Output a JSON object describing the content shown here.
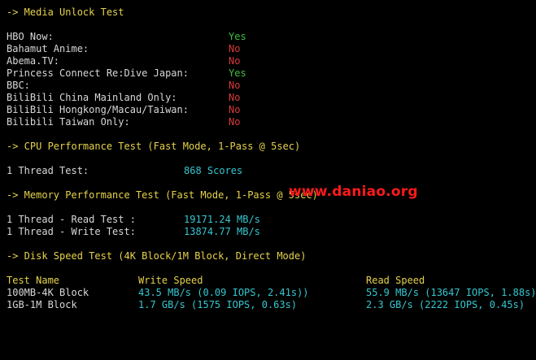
{
  "media": {
    "header": "-> Media Unlock Test",
    "rows": [
      {
        "label": "HBO Now:",
        "value": "Yes"
      },
      {
        "label": "Bahamut Anime:",
        "value": "No"
      },
      {
        "label": "Abema.TV:",
        "value": "No"
      },
      {
        "label": "Princess Connect Re:Dive Japan:",
        "value": "Yes"
      },
      {
        "label": "BBC:",
        "value": "No"
      },
      {
        "label": "BiliBili China Mainland Only:",
        "value": "No"
      },
      {
        "label": "BiliBili Hongkong/Macau/Taiwan:",
        "value": "No"
      },
      {
        "label": "Bilibili Taiwan Only:",
        "value": "No"
      }
    ]
  },
  "cpu": {
    "header": "-> CPU Performance Test (Fast Mode, 1-Pass @ 5sec)",
    "label": "1 Thread Test:",
    "value": "868 Scores"
  },
  "memory": {
    "header": "-> Memory Performance Test (Fast Mode, 1-Pass @ 5sec)",
    "rows": [
      {
        "label": "1 Thread - Read Test :",
        "value": "19171.24 MB/s"
      },
      {
        "label": "1 Thread - Write Test:",
        "value": "13874.77 MB/s"
      }
    ]
  },
  "disk": {
    "header": "-> Disk Speed Test (4K Block/1M Block, Direct Mode)",
    "columns": {
      "name": "Test Name",
      "write": "Write Speed",
      "read": "Read Speed"
    },
    "rows": [
      {
        "name": "100MB-4K Block",
        "write": "43.5 MB/s (0.09 IOPS, 2.41s))",
        "read": "55.9 MB/s (13647 IOPS, 1.88s)"
      },
      {
        "name": "1GB-1M Block",
        "write": "1.7 GB/s (1575 IOPS, 0.63s)",
        "read": "2.3 GB/s (2222 IOPS, 0.45s)"
      }
    ]
  },
  "watermark": "www.daniao.org",
  "colors": {
    "background": "#000000",
    "header": "#e6d24a",
    "yes": "#3fbf3f",
    "no": "#d83a3a",
    "value": "#36c7d0"
  }
}
